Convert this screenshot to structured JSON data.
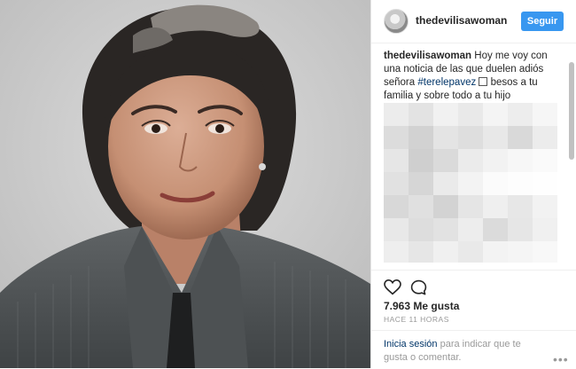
{
  "post": {
    "username": "thedevilisawoman",
    "follow_label": "Seguir",
    "caption_user": "thedevilisawoman",
    "caption_text_1": " Hoy me voy con una noticia de las que duelen adiós señora ",
    "caption_hashtag": "#terelepavez",
    "caption_text_2": " besos a tu familia y sobre todo a tu hijo",
    "likes": "7.963 Me gusta",
    "time": "HACE 11 HORAS"
  },
  "login": {
    "link": "Inicia sesión",
    "text": " para indicar que te gusta o comentar."
  },
  "more_label": "•••",
  "icons": [
    "heart-icon",
    "comment-icon",
    "more-options-icon"
  ],
  "colors": {
    "accent": "#3897f0",
    "link": "#003569",
    "muted": "#999999"
  }
}
